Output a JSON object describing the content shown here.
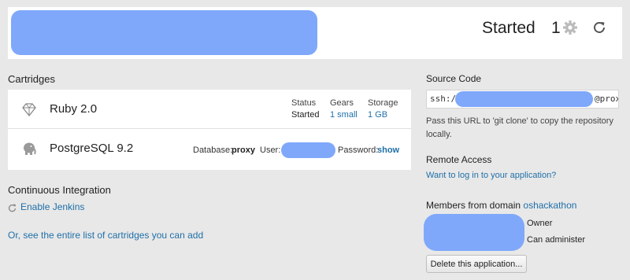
{
  "header": {
    "status": "Started",
    "gear_count": "1",
    "icons": {
      "gear": "gear-icon",
      "refresh": "refresh-icon"
    }
  },
  "cartridges": {
    "title": "Cartridges",
    "items": [
      {
        "name": "Ruby 2.0",
        "icon": "ruby-cartridge-icon",
        "status_label": "Status",
        "status_value": "Started",
        "gears_label": "Gears",
        "gears_value": "1 small",
        "storage_label": "Storage",
        "storage_value": "1 GB"
      },
      {
        "name": "PostgreSQL 9.2",
        "icon": "postgresql-elephant-icon",
        "database_label": "Database:",
        "database_value": "proxy",
        "user_label": "User:",
        "password_label": "Password:",
        "password_link": "show"
      }
    ]
  },
  "ci": {
    "title": "Continuous Integration",
    "enable_label": "Enable Jenkins",
    "icon": "refresh-small-icon"
  },
  "all_cartridges_link": "Or, see the entire list of cartridges you can add",
  "source_code": {
    "title": "Source Code",
    "prefix": "ssh://",
    "suffix": "@proxy",
    "help": "Pass this URL to 'git clone' to copy the repository locally."
  },
  "remote_access": {
    "title": "Remote Access",
    "link": "Want to log in to your application?"
  },
  "members": {
    "title_prefix": "Members from domain",
    "domain": "oshackathon",
    "roles": [
      "Owner",
      "Can administer"
    ]
  },
  "delete_button": "Delete this application...",
  "colors": {
    "background": "#e8e8e8",
    "card": "#ffffff",
    "link": "#1f6fa8",
    "redaction": "#7fa8fb"
  }
}
